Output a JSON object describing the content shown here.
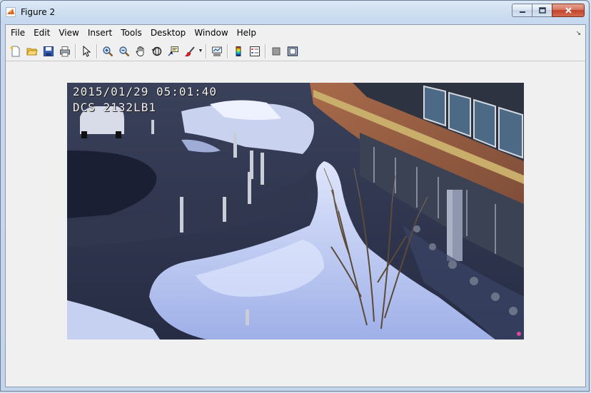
{
  "window": {
    "title": "Figure 2",
    "caption_buttons": {
      "minimize": "minimize",
      "maximize": "maximize",
      "close": "close"
    }
  },
  "menubar": {
    "items": [
      "File",
      "Edit",
      "View",
      "Insert",
      "Tools",
      "Desktop",
      "Window",
      "Help"
    ]
  },
  "toolbar": {
    "buttons": [
      "new-figure-icon",
      "open-file-icon",
      "save-icon",
      "print-icon",
      "edit-plot-arrow-icon",
      "zoom-in-icon",
      "zoom-out-icon",
      "pan-hand-icon",
      "rotate-3d-icon",
      "data-cursor-icon",
      "brush-icon",
      "link-plot-icon",
      "colorbar-icon",
      "legend-icon",
      "hide-plot-tools-icon",
      "show-plot-tools-icon"
    ]
  },
  "image": {
    "timestamp": "2015/01/29 05:01:40",
    "camera_id": "DCS 2132LB1",
    "description_icon": "camera-frame"
  },
  "colors": {
    "figure_background": "#f0f0f0",
    "close_button": "#c4432b",
    "title_bar": "#c7d9ee"
  }
}
